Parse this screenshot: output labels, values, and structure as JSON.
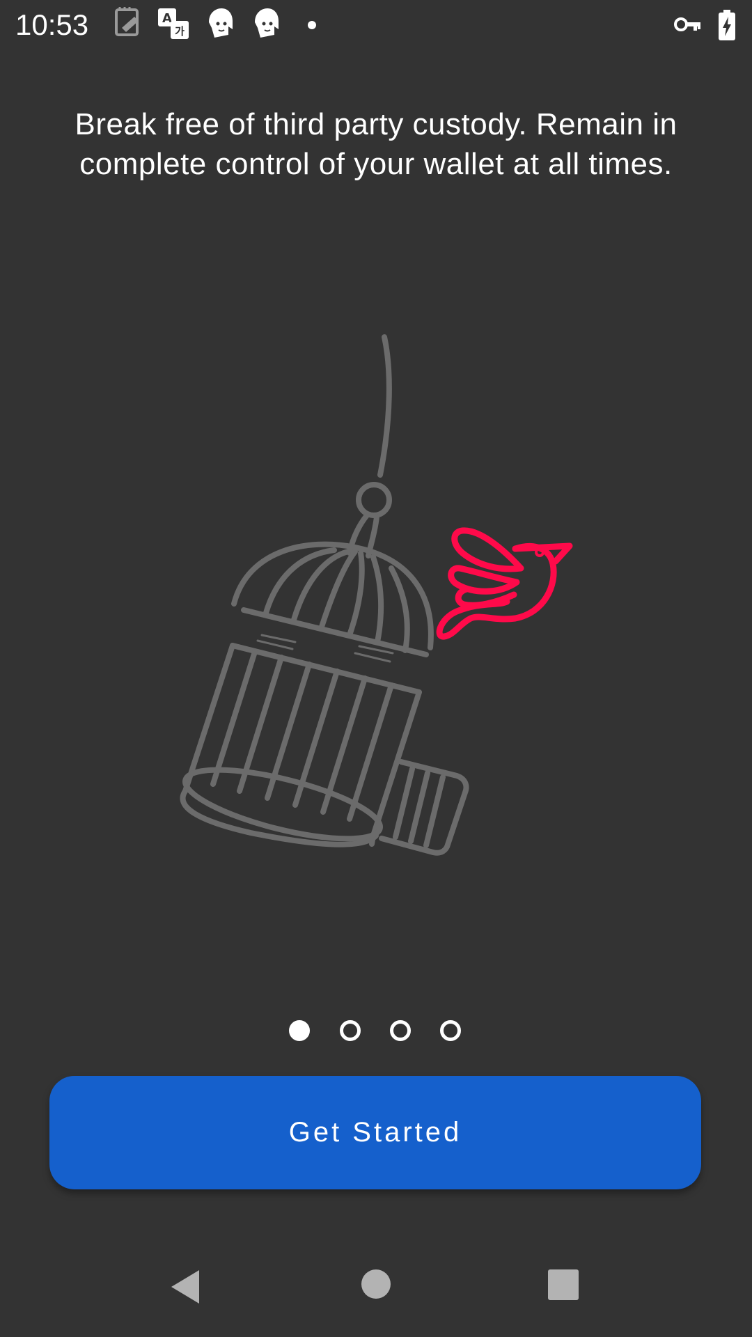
{
  "status_bar": {
    "time": "10:53",
    "left_icons": [
      "notes-icon",
      "translate-icon",
      "face-avatar-icon",
      "face-avatar-icon",
      "dot-icon"
    ],
    "right_icons": [
      "vpn-key-icon",
      "battery-charging-icon"
    ]
  },
  "onboarding": {
    "headline": "Break free of third party custody. Remain in complete control of your wallet at all times.",
    "illustration": {
      "cage_color": "#6B6B6B",
      "bird_color": "#FF0A4A"
    },
    "pager": {
      "count": 4,
      "active_index": 0
    },
    "button_label": "Get Started"
  },
  "colors": {
    "background": "#333333",
    "accent": "#1560CC",
    "bird": "#FF0A4A",
    "cage": "#6B6B6B",
    "nav": "#B3B3B3"
  },
  "nav_bar": {
    "buttons": [
      "back-icon",
      "home-icon",
      "recents-icon"
    ]
  }
}
